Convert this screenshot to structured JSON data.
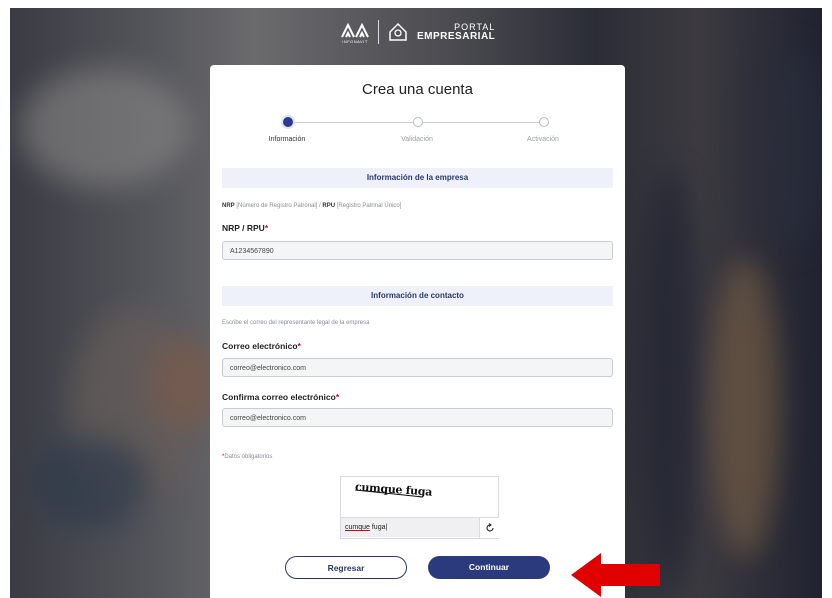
{
  "header": {
    "infonavit_label": "INFONAVIT",
    "portal_line1": "PORTAL",
    "portal_line2": "EMPRESARIAL"
  },
  "card": {
    "title": "Crea una cuenta"
  },
  "stepper": {
    "steps": [
      {
        "label": "Información",
        "state": "active"
      },
      {
        "label": "Validación",
        "state": "pending"
      },
      {
        "label": "Activación",
        "state": "pending"
      }
    ]
  },
  "company_section": {
    "title": "Información de la empresa",
    "hint_nrp": "NRP",
    "hint_nrp_desc": " [Número de Registro Patronal] / ",
    "hint_rpu": "RPU",
    "hint_rpu_desc": " [Registro Patrinal Único]",
    "nrp_label": "NRP / RPU",
    "nrp_value": "A1234567890"
  },
  "contact_section": {
    "title": "Información de contacto",
    "hint": "Escribe el correo del representante legal de la empresa",
    "email_label": "Correo electrónico",
    "email_value": "correo@electronico.com",
    "confirm_label": "Confirma correo electrónico",
    "confirm_value": "correo@electronico.com"
  },
  "required_mark": "*",
  "required_note": "Datos obligatorios",
  "captcha": {
    "image_text": "cumque fuga",
    "input_word1": "cumque",
    "input_word2": " fuga"
  },
  "buttons": {
    "back_label": "Regresar",
    "next_label": "Continuar"
  },
  "colors": {
    "primary": "#2b3a7c",
    "section_bg": "#eef1fa",
    "required": "#d0021b",
    "arrow": "#e00000"
  }
}
